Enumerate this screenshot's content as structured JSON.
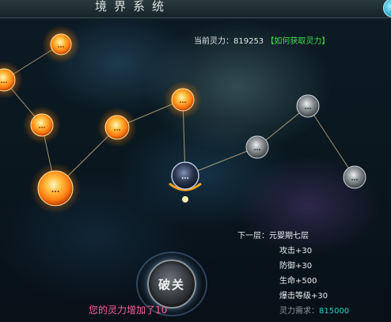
{
  "window": {
    "title": "境界系统"
  },
  "status": {
    "current_label": "当前灵力：",
    "current_value": "819253",
    "help_link": "【如何获取灵力】"
  },
  "nodes": [
    {
      "label": "…",
      "state": "lit"
    },
    {
      "label": "…",
      "state": "lit"
    },
    {
      "label": "…",
      "state": "lit"
    },
    {
      "label": "…",
      "state": "lit"
    },
    {
      "label": "…",
      "state": "lit"
    },
    {
      "label": "…",
      "state": "lit"
    },
    {
      "label": "…",
      "state": "current"
    },
    {
      "label": "…",
      "state": "locked"
    },
    {
      "label": "…",
      "state": "locked"
    },
    {
      "label": "…",
      "state": "locked"
    }
  ],
  "info": {
    "next_label": "下一层：元婴期七层",
    "stats": [
      "攻击+30",
      "防御+30",
      "生命+500",
      "爆击等级+30"
    ],
    "req_label": "灵力需求：",
    "req_value": "815000"
  },
  "break_button": {
    "label": "破关"
  },
  "message": "您的灵力增加了10",
  "colors": {
    "lit": "#ff9a1e",
    "current": "#3a4a63",
    "locked": "#8a8f94",
    "link": "#39e04a",
    "message": "#ff5fa0",
    "requirement": "#2fd0c8"
  }
}
